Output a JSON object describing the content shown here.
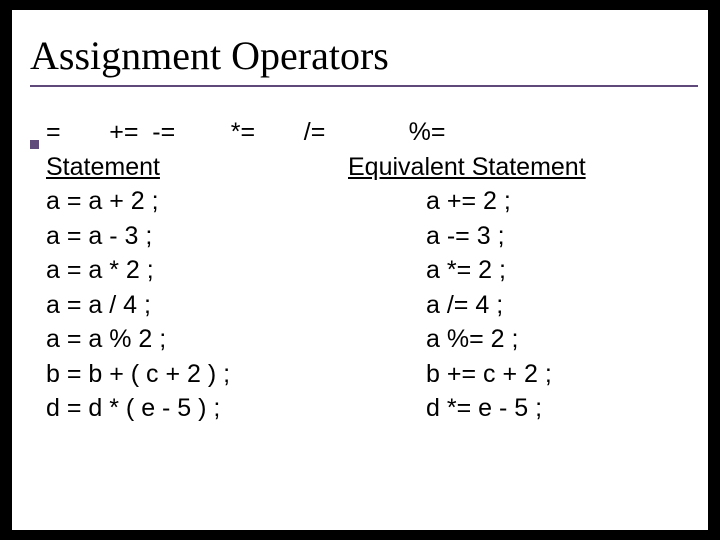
{
  "title": "Assignment Operators",
  "operators": "=       +=  -=        *=       /=            %=",
  "headers": {
    "left": "Statement",
    "right": "Equivalent Statement"
  },
  "rows": [
    {
      "stmt": "a = a + 2 ;",
      "equiv": "a += 2 ;"
    },
    {
      "stmt": "a = a - 3 ;",
      "equiv": "a -= 3 ;"
    },
    {
      "stmt": "a = a * 2 ;",
      "equiv": "a *= 2 ;"
    },
    {
      "stmt": "a = a / 4 ;",
      "equiv": "a /= 4 ;"
    },
    {
      "stmt": "a = a % 2 ;",
      "equiv": "a %= 2 ;"
    },
    {
      "stmt": "b = b + ( c + 2 ) ;",
      "equiv": "b += c + 2 ;"
    },
    {
      "stmt": "d = d * ( e - 5 ) ;",
      "equiv": "d *= e - 5 ;"
    }
  ]
}
